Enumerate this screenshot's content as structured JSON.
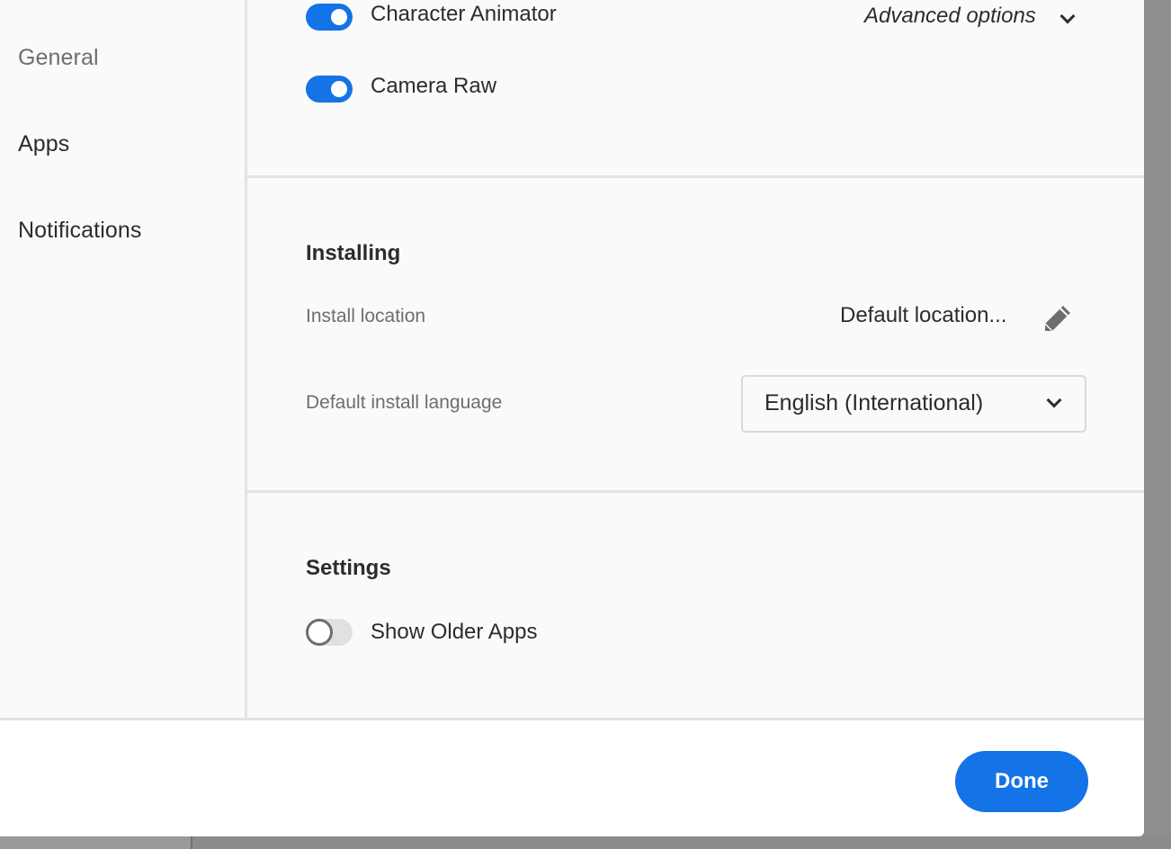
{
  "sidebar": {
    "items": [
      {
        "label": "General"
      },
      {
        "label": "Apps"
      },
      {
        "label": "Notifications"
      }
    ]
  },
  "apps_list": {
    "advanced_options_label": "Advanced options",
    "toggles": [
      {
        "label": "Character Animator",
        "on": true
      },
      {
        "label": "Camera Raw",
        "on": true
      }
    ]
  },
  "installing": {
    "title": "Installing",
    "install_location_label": "Install location",
    "install_location_value": "Default location...",
    "default_language_label": "Default install language",
    "default_language_value": "English (International)"
  },
  "settings": {
    "title": "Settings",
    "show_older_apps_label": "Show Older Apps",
    "show_older_apps_on": false
  },
  "footer": {
    "done_label": "Done"
  },
  "colors": {
    "accent": "#1473e6",
    "background": "#fafafa",
    "divider": "#e3e3e3"
  }
}
